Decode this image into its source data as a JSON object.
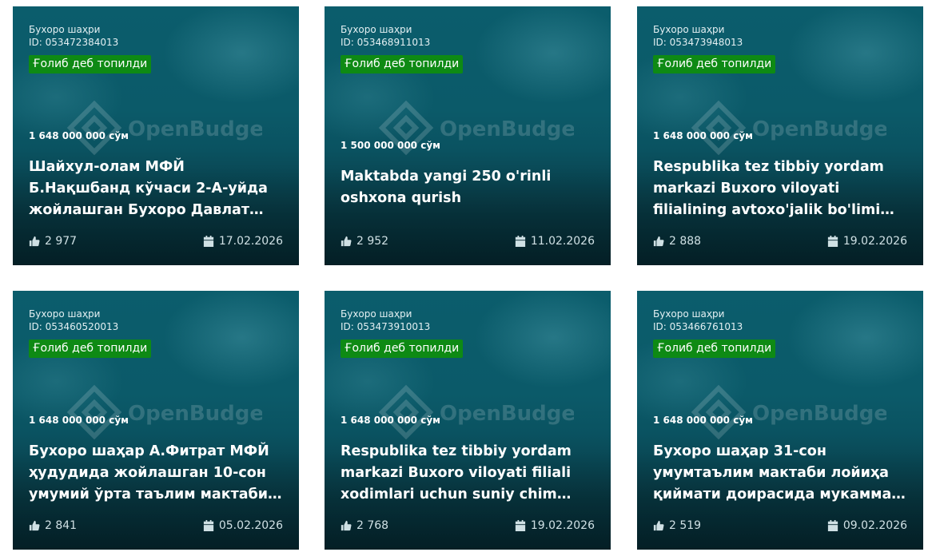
{
  "cards": [
    {
      "region": "Бухоро шаҳри",
      "id": "ID: 053472384013",
      "status": "Ғолиб деб топилди",
      "amount": "1 648 000 000 сўм",
      "title": "Шайхул-олам МФЙ Б.Нақшбанд кўчаси 2-А-уйда жойлашган Бухоро Давлат тиббиёт институти",
      "likes": "2 977",
      "date": "17.02.2026"
    },
    {
      "region": "Бухоро шаҳри",
      "id": "ID: 053468911013",
      "status": "Ғолиб деб топилди",
      "amount": "1 500 000 000 сўм",
      "title": "Maktabda yangi 250 o'rinli oshxona qurish",
      "likes": "2 952",
      "date": "11.02.2026"
    },
    {
      "region": "Бухоро шаҳри",
      "id": "ID: 053473948013",
      "status": "Ғолиб деб топилди",
      "amount": "1 648 000 000 сўм",
      "title": "Respublika tez tibbiy yordam markazi Buxoro viloyati filialining avtoxo'jalik bo'limi binosini ta'mirlash",
      "likes": "2 888",
      "date": "19.02.2026"
    },
    {
      "region": "Бухоро шаҳри",
      "id": "ID: 053460520013",
      "status": "Ғолиб деб топилди",
      "amount": "1 648 000 000 сўм",
      "title": "Бухоро шаҳар А.Фитрат МФЙ ҳудудида жойлашган 10-сон умумий ўрта таълим мактаби биносини таъмирлаш",
      "likes": "2 841",
      "date": "05.02.2026"
    },
    {
      "region": "Бухоро шаҳри",
      "id": "ID: 053473910013",
      "status": "Ғолиб деб топилди",
      "amount": "1 648 000 000 сўм",
      "title": "Respublika tez tibbiy yordam markazi Buxoro viloyati filiali xodimlari uchun suniy chim maydon qurish",
      "likes": "2 768",
      "date": "19.02.2026"
    },
    {
      "region": "Бухоро шаҳри",
      "id": "ID: 053466761013",
      "status": "Ғолиб деб топилди",
      "amount": "1 648 000 000 сўм",
      "title": "Бухоро шаҳар 31-сон умумтаълим мактаби лойиҳа қиймати доирасида мукаммал таъмирлаш",
      "likes": "2 519",
      "date": "09.02.2026"
    }
  ],
  "watermark_text": "OpenBudget",
  "icons": {
    "likes": "thumbs-up-icon",
    "date": "calendar-icon"
  },
  "colors": {
    "badge": "#0e8a14",
    "card_top": "#0b5d6c",
    "card_bottom": "#062f39"
  }
}
